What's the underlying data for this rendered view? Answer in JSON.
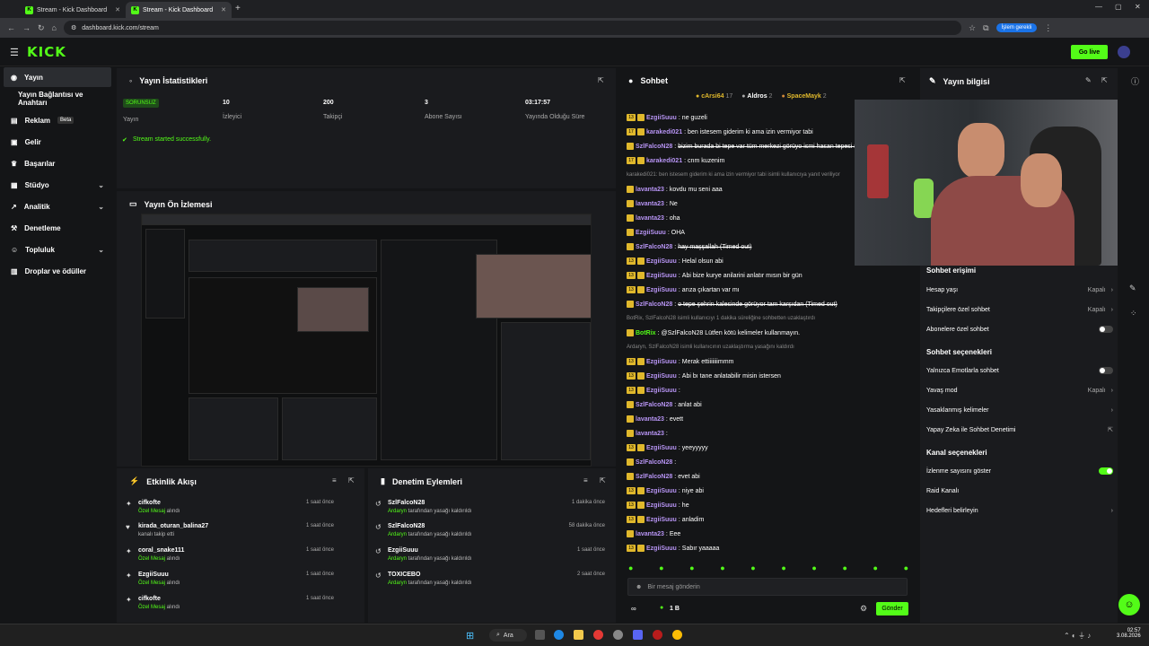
{
  "browser": {
    "tabs": [
      {
        "label": "Stream - Kick Dashboard"
      },
      {
        "label": "Stream - Kick Dashboard"
      }
    ],
    "url": "dashboard.kick.com/stream",
    "profile_label": "İşlem gerekli"
  },
  "header": {
    "logo": "KICK",
    "go_live": "Go live"
  },
  "sidebar": {
    "items": [
      {
        "label": "Yayın"
      },
      {
        "label": "Yayın Bağlantısı ve Anahtarı"
      },
      {
        "label": "Reklam",
        "badge": "Beta"
      },
      {
        "label": "Gelir"
      },
      {
        "label": "Başarılar"
      },
      {
        "label": "Stüdyo"
      },
      {
        "label": "Analitik"
      },
      {
        "label": "Denetleme"
      },
      {
        "label": "Topluluk"
      },
      {
        "label": "Droplar ve ödüller"
      }
    ]
  },
  "stats": {
    "title": "Yayın İstatistikleri",
    "badge": "SORUNSUZ",
    "items": [
      {
        "value": "",
        "label": "Yayın"
      },
      {
        "value": "10",
        "label": "İzleyici"
      },
      {
        "value": "200",
        "label": "Takipçi"
      },
      {
        "value": "3",
        "label": "Abone Sayısı"
      },
      {
        "value": "03:17:57",
        "label": "Yayında Olduğu Süre"
      }
    ],
    "status": "Stream started successfully."
  },
  "preview": {
    "title": "Yayın Ön İzlemesi"
  },
  "activity": {
    "title": "Etkinlik Akışı",
    "rows": [
      {
        "name": "cifkofte",
        "action": "Özel Mesaj",
        "rest": " alındı",
        "time": "1 saat önce"
      },
      {
        "name": "kirada_oturan_balina27",
        "action": "",
        "rest": "kanalı takip etti",
        "time": "1 saat önce"
      },
      {
        "name": "coral_snake111",
        "action": "Özel Mesaj",
        "rest": " alındı",
        "time": "1 saat önce"
      },
      {
        "name": "EzgiiSuuu",
        "action": "Özel Mesaj",
        "rest": " alındı",
        "time": "1 saat önce"
      },
      {
        "name": "cifkofte",
        "action": "Özel Mesaj",
        "rest": " alındı",
        "time": "1 saat önce"
      }
    ]
  },
  "moderation": {
    "title": "Denetim Eylemleri",
    "rows": [
      {
        "name": "SzlFalcoN28",
        "action": "Ardaryn",
        "rest": " tarafından yasağı kaldırıldı",
        "time": "1 dakika önce"
      },
      {
        "name": "SzlFalcoN28",
        "action": "Ardaryn",
        "rest": " tarafından yasağı kaldırıldı",
        "time": "58 dakika önce"
      },
      {
        "name": "EzgiiSuuu",
        "action": "Ardaryn",
        "rest": " tarafından yasağı kaldırıldı",
        "time": "1 saat önce"
      },
      {
        "name": "TOXICEBO",
        "action": "Ardaryn",
        "rest": " tarafından yasağı kaldırıldı",
        "time": "2 saat önce"
      }
    ]
  },
  "chat": {
    "title": "Sohbet",
    "top_gifters": [
      {
        "name": "cArsi64",
        "count": "17"
      },
      {
        "name": "Aldros",
        "count": "2"
      },
      {
        "name": "SpaceMayk",
        "count": "2"
      }
    ],
    "messages": [
      {
        "lv": "13",
        "user": "EzgiiSuuu",
        "color": "#b794f4",
        "text": "ne guzeli",
        "strike": false
      },
      {
        "lv": "17",
        "user": "karakedi021",
        "color": "#b794f4",
        "text": "ben istesem giderim ki ama izin vermiyor tabi",
        "strike": false
      },
      {
        "lv": "",
        "user": "SzlFalcoN28",
        "color": "#b794f4",
        "text": "bizim burada bi tepe var tüm merkezi görüyo ismi hasan tepesi seven...",
        "strike": true
      },
      {
        "lv": "17",
        "user": "karakedi021",
        "color": "#b794f4",
        "text": "cnm kuzenim",
        "strike": false
      },
      {
        "lv": "",
        "user": "",
        "color": "#888",
        "text": "karakedi021: ben istesem giderim ki ama izin vermiyor tabi isimli kullanıcıya yanıt veriliyor",
        "strike": false
      },
      {
        "lv": "",
        "user": "lavanta23",
        "color": "#b794f4",
        "text": "kovdu mu seni aaa",
        "strike": false
      },
      {
        "lv": "",
        "user": "lavanta23",
        "color": "#b794f4",
        "text": "Ne",
        "strike": false
      },
      {
        "lv": "",
        "user": "lavanta23",
        "color": "#b794f4",
        "text": "oha",
        "strike": false
      },
      {
        "lv": "",
        "user": "EzgiiSuuu",
        "color": "#b794f4",
        "text": "OHA",
        "strike": false
      },
      {
        "lv": "",
        "user": "SzlFalcoN28",
        "color": "#b794f4",
        "text": "hay maşşallah (Timed out)",
        "strike": true
      },
      {
        "lv": "13",
        "user": "EzgiiSuuu",
        "color": "#b794f4",
        "text": "Helal olsun abi",
        "strike": false
      },
      {
        "lv": "13",
        "user": "EzgiiSuuu",
        "color": "#b794f4",
        "text": "Abi bize kurye anilarini anlatır mısın bir gün",
        "strike": false
      },
      {
        "lv": "13",
        "user": "EzgiiSuuu",
        "color": "#b794f4",
        "text": "arıza çıkartan var mı",
        "strike": false
      },
      {
        "lv": "",
        "user": "SzlFalcoN28",
        "color": "#b794f4",
        "text": "o tepe şehrin kalesinde görüyor tam karşıdan (Timed out)",
        "strike": true
      },
      {
        "lv": "",
        "user": "",
        "color": "#888",
        "text": "BotRix, SzlFalcoN28 isimli kullanıcıyı 1 dakika süreliğine sohbetten uzaklaştırdı",
        "strike": false
      },
      {
        "lv": "",
        "user": "BotRix",
        "color": "#53fc18",
        "text": "@SzlFalcoN28 Lütfen kötü kelimeler kullanmayın.",
        "strike": false
      },
      {
        "lv": "",
        "user": "",
        "color": "#888",
        "text": "Ardaryn, SzlFalcoN28 isimli kullanıcının uzaklaştırma yasağını kaldırdı",
        "strike": false
      },
      {
        "lv": "13",
        "user": "EzgiiSuuu",
        "color": "#b794f4",
        "text": "Merak ettiiiiiiimmm",
        "strike": false
      },
      {
        "lv": "13",
        "user": "EzgiiSuuu",
        "color": "#b794f4",
        "text": "Abi bı tane anlatabilir misin istersen",
        "strike": false
      },
      {
        "lv": "13",
        "user": "EzgiiSuuu",
        "color": "#b794f4",
        "text": "",
        "strike": false
      },
      {
        "lv": "",
        "user": "SzlFalcoN28",
        "color": "#b794f4",
        "text": "anlat abi",
        "strike": false
      },
      {
        "lv": "",
        "user": "lavanta23",
        "color": "#b794f4",
        "text": "evett",
        "strike": false
      },
      {
        "lv": "",
        "user": "lavanta23",
        "color": "#b794f4",
        "text": "",
        "strike": false
      },
      {
        "lv": "13",
        "user": "EzgiiSuuu",
        "color": "#b794f4",
        "text": "yeeyyyyy",
        "strike": false
      },
      {
        "lv": "",
        "user": "SzlFalcoN28",
        "color": "#b794f4",
        "text": "",
        "strike": false
      },
      {
        "lv": "",
        "user": "SzlFalcoN28",
        "color": "#b794f4",
        "text": "evet abi",
        "strike": false
      },
      {
        "lv": "13",
        "user": "EzgiiSuuu",
        "color": "#b794f4",
        "text": "niye abi",
        "strike": false
      },
      {
        "lv": "13",
        "user": "EzgiiSuuu",
        "color": "#b794f4",
        "text": "he",
        "strike": false
      },
      {
        "lv": "13",
        "user": "EzgiiSuuu",
        "color": "#b794f4",
        "text": "anladim",
        "strike": false
      },
      {
        "lv": "",
        "user": "lavanta23",
        "color": "#b794f4",
        "text": "Eee",
        "strike": false
      },
      {
        "lv": "13",
        "user": "EzgiiSuuu",
        "color": "#b794f4",
        "text": "Sabır yaaaaa",
        "strike": false
      }
    ],
    "input_placeholder": "Bir mesaj gönderin",
    "viewer_count": "1 B",
    "send_label": "Gönder"
  },
  "info": {
    "title": "Yayın bilgisi",
    "sections": {
      "chat_access": "Sohbet erişimi",
      "chat_options": "Sohbet seçenekleri",
      "channel_options": "Kanal seçenekleri"
    },
    "rows": {
      "account_age": {
        "label": "Hesap yaşı",
        "value": "Kapalı"
      },
      "follower_chat": {
        "label": "Takipçilere özel sohbet",
        "value": "Kapalı"
      },
      "sub_chat": {
        "label": "Abonelere özel sohbet"
      },
      "emote_only": {
        "label": "Yalnızca Emotlarla sohbet"
      },
      "slow_mode": {
        "label": "Yavaş mod",
        "value": "Kapalı"
      },
      "banned_words": {
        "label": "Yasaklanmış kelimeler"
      },
      "ai_moderation": {
        "label": "Yapay Zeka ile Sohbet Denetimi"
      },
      "show_viewers": {
        "label": "İzlenme sayısını göster"
      },
      "raid": {
        "label": "Raid Kanalı"
      },
      "goals": {
        "label": "Hedefleri belirleyin"
      }
    }
  },
  "taskbar": {
    "search": "Ara",
    "time": "02:57",
    "date": "3.08.2026"
  },
  "colors": {
    "accent": "#53fc18",
    "panel": "#1a1b1e",
    "bg": "#141517"
  }
}
